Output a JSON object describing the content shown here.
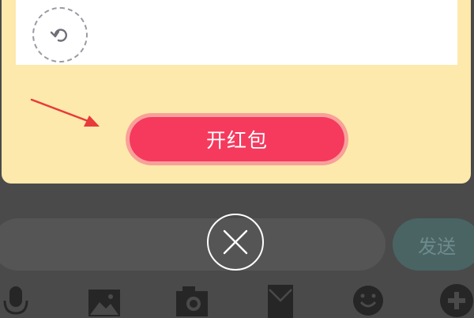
{
  "modal": {
    "open_button_label": "开红包",
    "colors": {
      "card_bg": "#fde9ab",
      "button": "#f53a5e",
      "button_ring": "#f8a09a"
    }
  },
  "input_bar": {
    "send_label": "发送"
  },
  "toolbar": {
    "icons": [
      "microphone-icon",
      "image-icon",
      "camera-icon",
      "red-packet-icon",
      "emoji-icon",
      "plus-icon"
    ]
  }
}
